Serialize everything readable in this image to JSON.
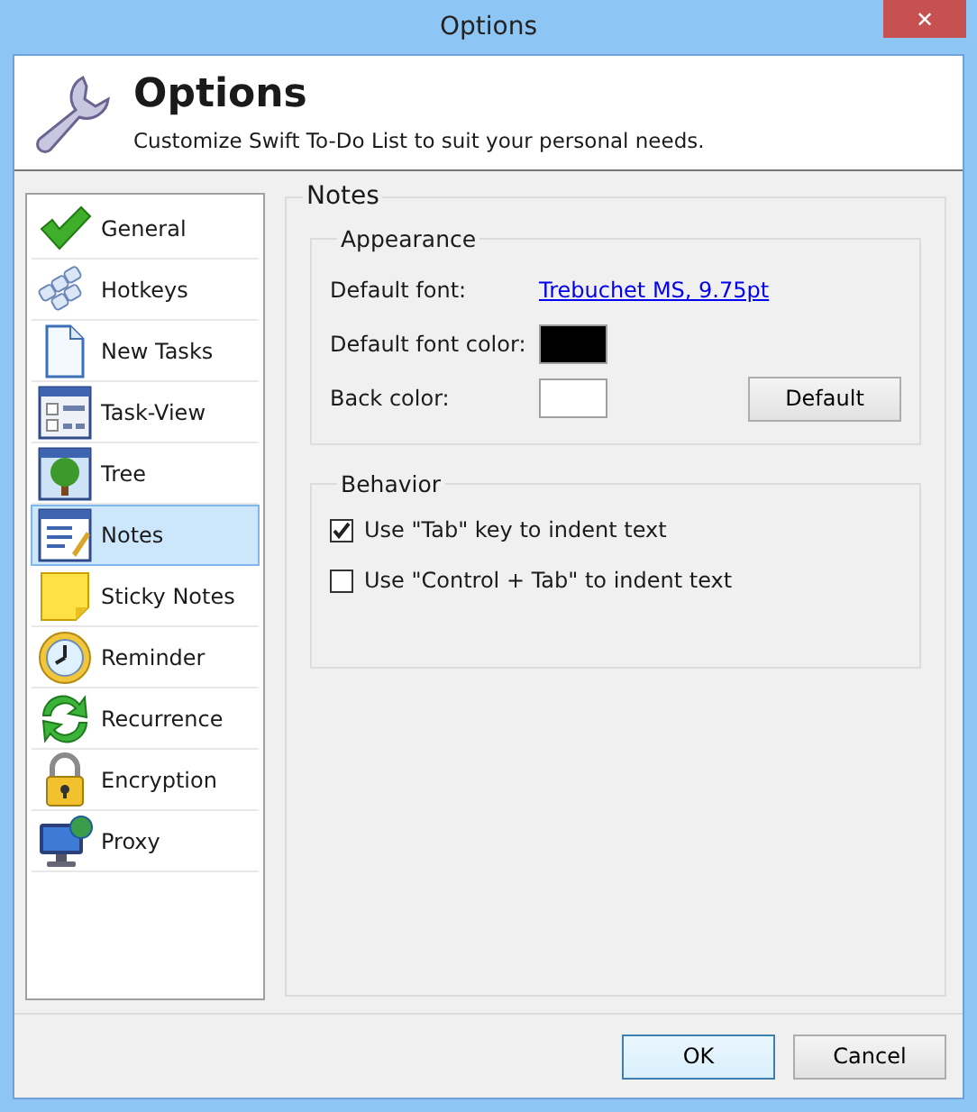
{
  "window": {
    "title": "Options",
    "close": "✕"
  },
  "header": {
    "title": "Options",
    "subtitle": "Customize Swift To-Do List to suit your personal needs."
  },
  "sidebar": {
    "items": [
      {
        "label": "General",
        "selected": false
      },
      {
        "label": "Hotkeys",
        "selected": false
      },
      {
        "label": "New Tasks",
        "selected": false
      },
      {
        "label": "Task-View",
        "selected": false
      },
      {
        "label": "Tree",
        "selected": false
      },
      {
        "label": "Notes",
        "selected": true
      },
      {
        "label": "Sticky Notes",
        "selected": false
      },
      {
        "label": "Reminder",
        "selected": false
      },
      {
        "label": "Recurrence",
        "selected": false
      },
      {
        "label": "Encryption",
        "selected": false
      },
      {
        "label": "Proxy",
        "selected": false
      }
    ]
  },
  "panel": {
    "title": "Notes",
    "appearance": {
      "title": "Appearance",
      "font_label": "Default font:",
      "font_value": "Trebuchet MS, 9.75pt",
      "color_rows": [
        {
          "label": "Default font color:",
          "color": "#000000"
        },
        {
          "label": "Back color:",
          "color": "#ffffff"
        }
      ],
      "default_button": "Default"
    },
    "behavior": {
      "title": "Behavior",
      "options": [
        {
          "label": "Use \"Tab\" key to indent text",
          "checked": true
        },
        {
          "label": "Use \"Control + Tab\" to indent text",
          "checked": false
        }
      ]
    }
  },
  "buttons": [
    "OK",
    "Cancel"
  ]
}
